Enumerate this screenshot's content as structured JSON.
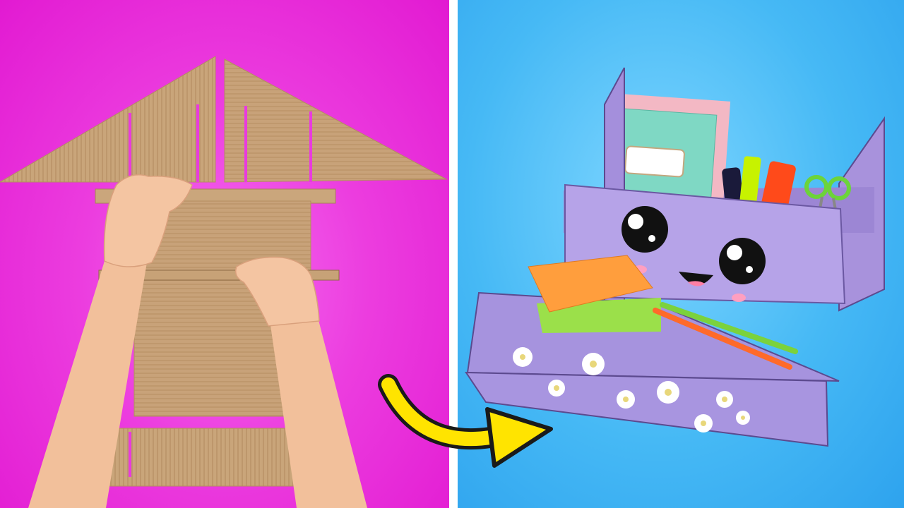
{
  "scene": {
    "left_background": "#e93adf",
    "right_background": "#46b9f5",
    "cardboard": "#c9a57a",
    "organizer_color": "#b9a6e6",
    "arrow_color": "#ffe400"
  },
  "icons": {
    "arrow": "curved-arrow-icon",
    "flower": "daisy-flower-icon"
  }
}
